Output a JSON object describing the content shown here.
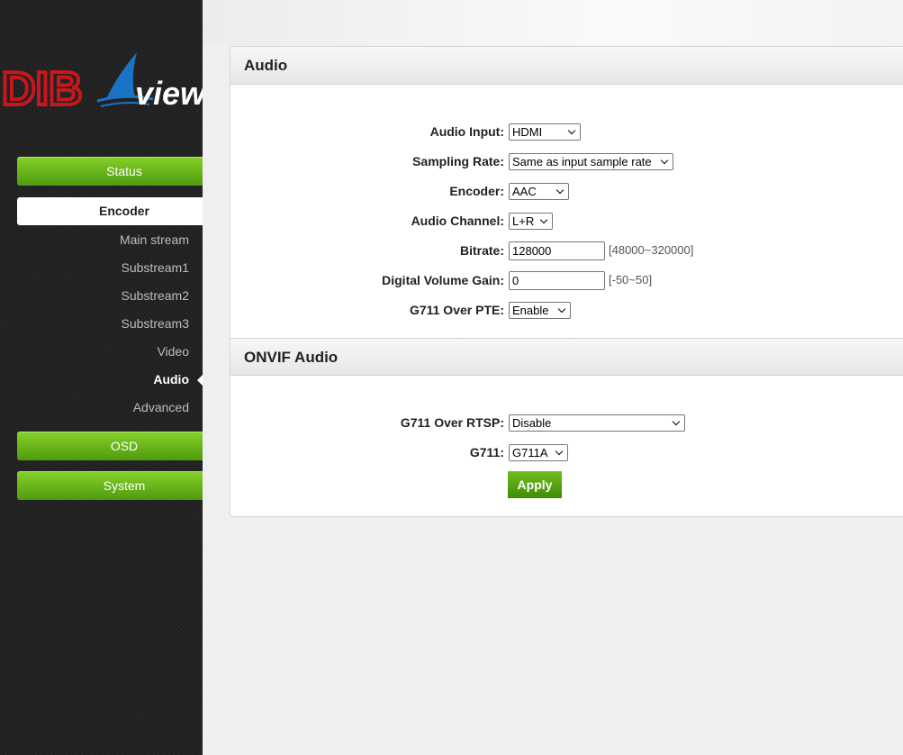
{
  "brand": {
    "left_text": "DIB",
    "right_text": "view"
  },
  "sidebar": {
    "status": "Status",
    "encoder": "Encoder",
    "subitems": [
      "Main stream",
      "Substream1",
      "Substream2",
      "Substream3",
      "Video",
      "Audio",
      "Advanced"
    ],
    "osd": "OSD",
    "system": "System"
  },
  "audio": {
    "title": "Audio",
    "audio_input": {
      "label": "Audio Input:",
      "value": "HDMI"
    },
    "sampling_rate": {
      "label": "Sampling Rate:",
      "value": "Same as input sample rate"
    },
    "encoder": {
      "label": "Encoder:",
      "value": "AAC"
    },
    "audio_channel": {
      "label": "Audio Channel:",
      "value": "L+R"
    },
    "bitrate": {
      "label": "Bitrate:",
      "value": "128000",
      "range": "[48000~320000]"
    },
    "volume_gain": {
      "label": "Digital Volume Gain:",
      "value": "0",
      "range": "[-50~50]"
    },
    "g711_pte": {
      "label": "G711 Over PTE:",
      "value": "Enable"
    }
  },
  "onvif": {
    "title": "ONVIF Audio",
    "g711_rtsp": {
      "label": "G711 Over RTSP:",
      "value": "Disable"
    },
    "g711": {
      "label": "G711:",
      "value": "G711A"
    },
    "apply": "Apply"
  },
  "colors": {
    "accent_green": "#5fae16",
    "brand_red": "#c8161d",
    "brand_blue": "#1a73c4"
  }
}
